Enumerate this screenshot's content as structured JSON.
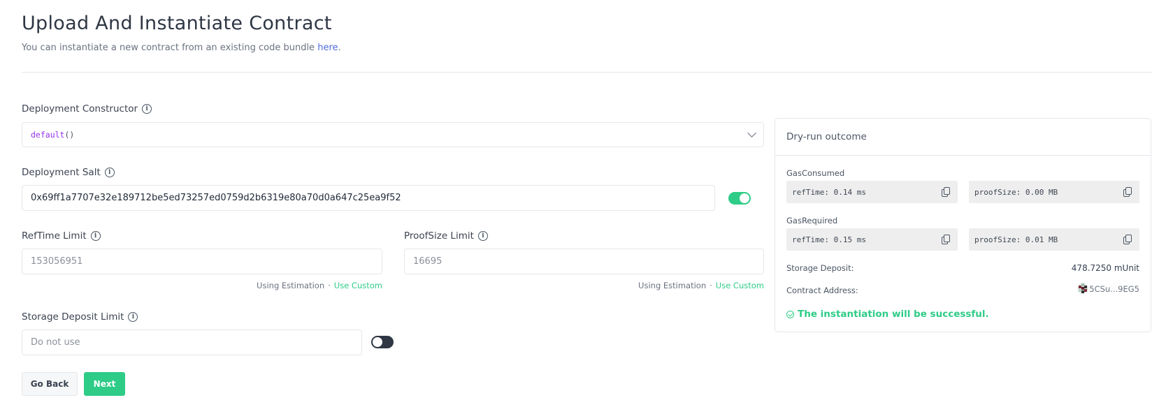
{
  "header": {
    "title": "Upload And Instantiate Contract",
    "subtitle": "You can instantiate a new contract from an existing code bundle ",
    "subtitle_link": "here",
    "subtitle_end": "."
  },
  "form": {
    "constructor": {
      "label": "Deployment Constructor",
      "selected_name": "default",
      "selected_args": "()"
    },
    "salt": {
      "label": "Deployment Salt",
      "value": "0x69ff1a7707e32e189712be5ed73257ed0759d2b6319e80a70d0a647c25ea9f52",
      "toggle_on": true
    },
    "reftime": {
      "label": "RefTime Limit",
      "value": "153056951",
      "helper_status": "Using Estimation",
      "helper_sep": "·",
      "helper_link": "Use Custom"
    },
    "proofsize": {
      "label": "ProofSize Limit",
      "value": "16695",
      "helper_status": "Using Estimation",
      "helper_sep": "·",
      "helper_link": "Use Custom"
    },
    "storage": {
      "label": "Storage Deposit Limit",
      "placeholder": "Do not use",
      "toggle_on": false
    }
  },
  "buttons": {
    "back": "Go Back",
    "next": "Next"
  },
  "dryrun": {
    "title": "Dry-run outcome",
    "gas_consumed": {
      "label": "GasConsumed",
      "ref_time": "refTime: 0.14 ms",
      "proof_size": "proofSize: 0.00 MB"
    },
    "gas_required": {
      "label": "GasRequired",
      "ref_time": "refTime: 0.15 ms",
      "proof_size": "proofSize: 0.01 MB"
    },
    "storage_deposit": {
      "label": "Storage Deposit:",
      "value": "478.7250 mUnit"
    },
    "contract_address": {
      "label": "Contract Address:",
      "value": "5CSu...9EG5"
    },
    "result": "The instantiation will be successful."
  },
  "colors": {
    "accent": "#2ecc87",
    "link": "#4f6bdc",
    "constructor_name": "#9333ea"
  }
}
